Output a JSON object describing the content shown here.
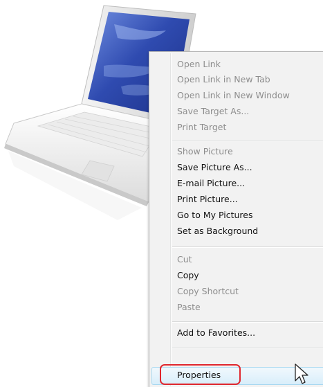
{
  "context_menu": {
    "groups": [
      {
        "items": [
          {
            "label": "Open Link",
            "enabled": false
          },
          {
            "label": "Open Link in New Tab",
            "enabled": false
          },
          {
            "label": "Open Link in New Window",
            "enabled": false
          },
          {
            "label": "Save Target As...",
            "enabled": false
          },
          {
            "label": "Print Target",
            "enabled": false
          }
        ]
      },
      {
        "items": [
          {
            "label": "Show Picture",
            "enabled": false
          },
          {
            "label": "Save Picture As...",
            "enabled": true
          },
          {
            "label": "E-mail Picture...",
            "enabled": true
          },
          {
            "label": "Print Picture...",
            "enabled": true
          },
          {
            "label": "Go to My Pictures",
            "enabled": true
          },
          {
            "label": "Set as Background",
            "enabled": true
          }
        ]
      },
      {
        "items": [
          {
            "label": "Cut",
            "enabled": false
          },
          {
            "label": "Copy",
            "enabled": true
          },
          {
            "label": "Copy Shortcut",
            "enabled": false
          },
          {
            "label": "Paste",
            "enabled": false
          }
        ]
      },
      {
        "items": [
          {
            "label": "Add to Favorites...",
            "enabled": true
          }
        ]
      },
      {
        "items": [
          {
            "label": "Properties",
            "enabled": true,
            "hovered": true,
            "circled": true
          }
        ]
      }
    ]
  },
  "colors": {
    "menu_background": "#f2f2f2",
    "disabled_text": "#8d8d8d",
    "enabled_text": "#111111",
    "hover_fill": "#d9eefa",
    "annotation_ring": "#e0262d",
    "laptop_screen": "#2f4bb0"
  },
  "icons": {
    "cursor": "mouse-pointer-icon",
    "image": "laptop-image"
  }
}
